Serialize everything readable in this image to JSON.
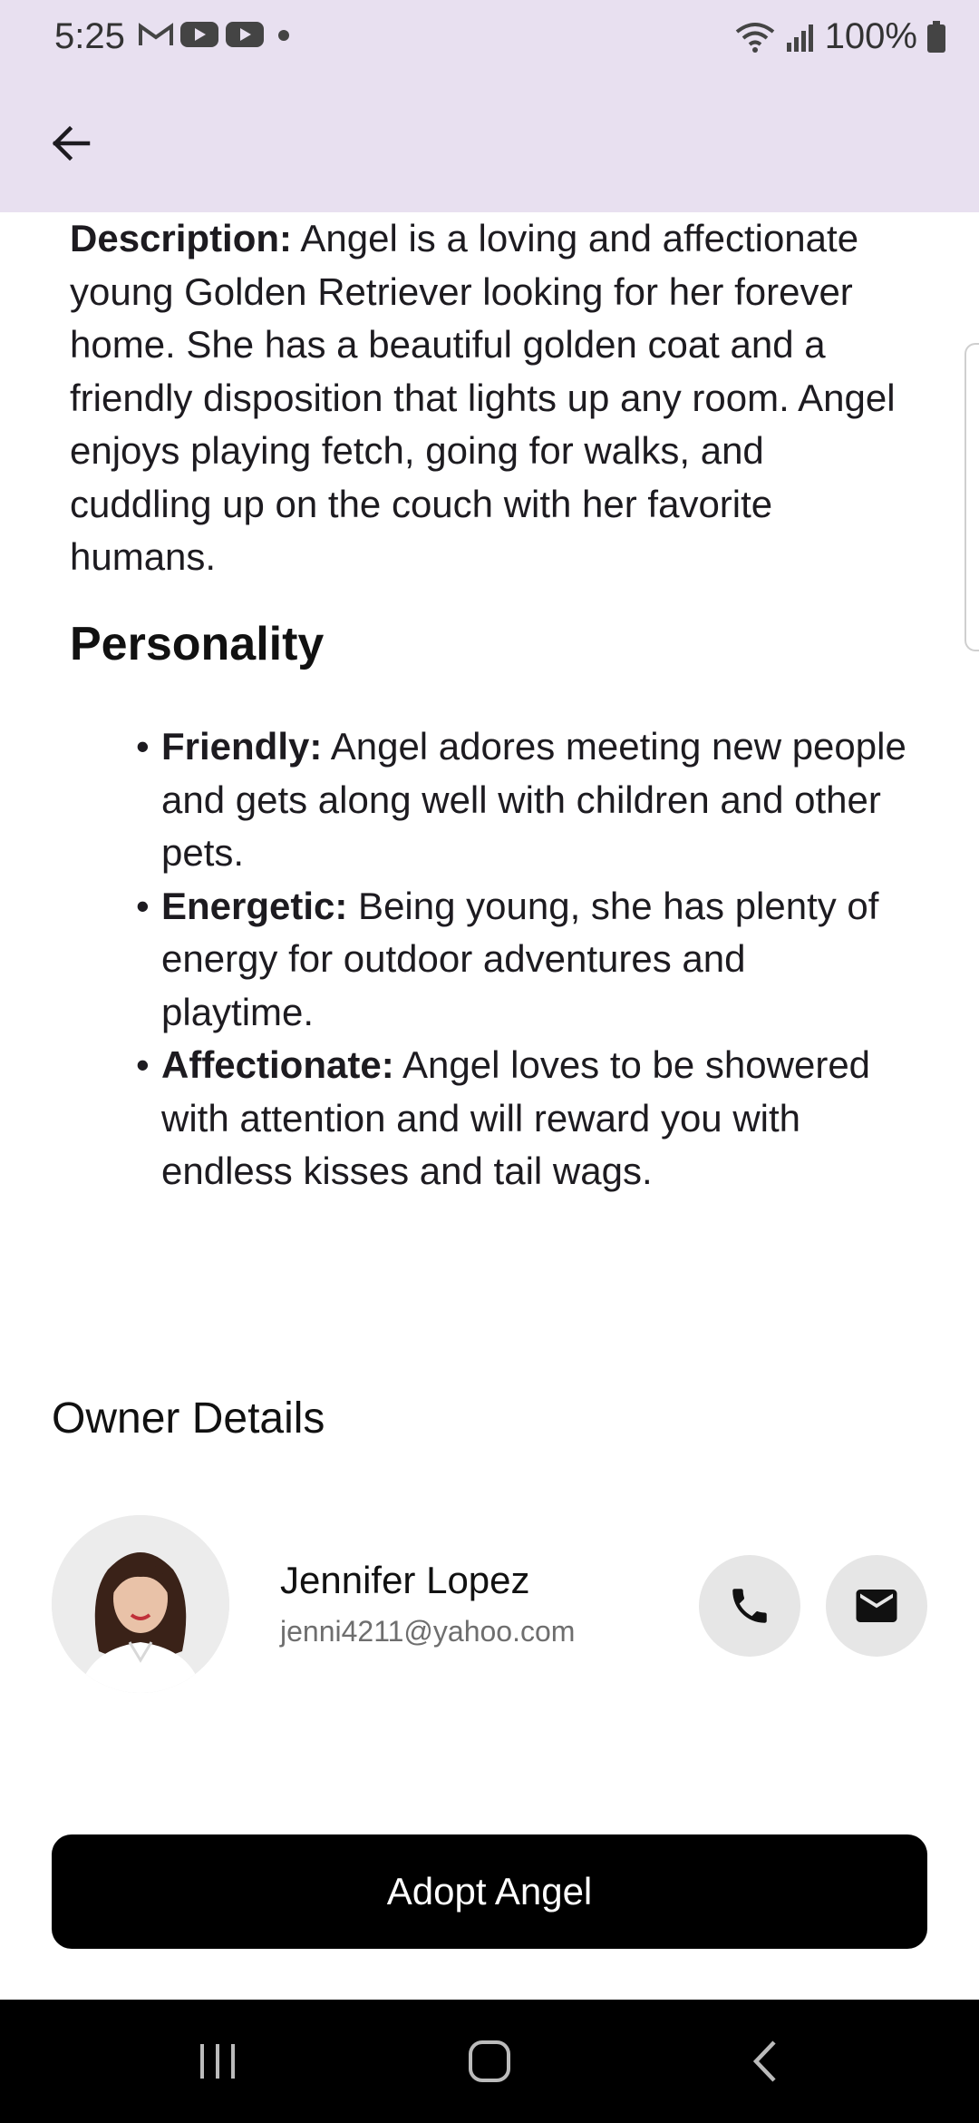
{
  "status_bar": {
    "time": "5:25",
    "battery": "100%",
    "left_icons": [
      "gmail-icon",
      "youtube-icon",
      "youtube-icon",
      "dot-icon"
    ],
    "right_icons": [
      "wifi-icon",
      "signal-icon",
      "battery-icon"
    ]
  },
  "app_bar": {
    "back_icon": "arrow-left-icon"
  },
  "description": {
    "label": "Description:",
    "text": " Angel is a loving and affectionate young Golden Retriever looking for her forever home. She has a beautiful golden coat and a friendly disposition that lights up any room. Angel enjoys playing fetch, going for walks, and cuddling up on the couch with her favorite humans."
  },
  "personality": {
    "heading": "Personality",
    "traits": [
      {
        "label": "Friendly:",
        "text": " Angel adores meeting new people and gets along well with children and other pets."
      },
      {
        "label": "Energetic:",
        "text": " Being young, she has plenty of energy for outdoor adventures and playtime."
      },
      {
        "label": "Affectionate:",
        "text": " Angel loves to be showered with attention and will reward you with endless kisses and tail wags."
      }
    ]
  },
  "owner": {
    "heading": "Owner Details",
    "name": "Jennifer Lopez",
    "email": "jenni4211@yahoo.com",
    "call_icon": "phone-icon",
    "mail_icon": "mail-icon"
  },
  "adopt_button": {
    "label": "Adopt Angel"
  },
  "nav_bar": {
    "items": [
      "recents-icon",
      "home-icon",
      "back-icon"
    ]
  },
  "colors": {
    "app_bar_bg": "#e8e0f0",
    "button_bg": "#000000",
    "circle_btn_bg": "#e6e6e6"
  }
}
